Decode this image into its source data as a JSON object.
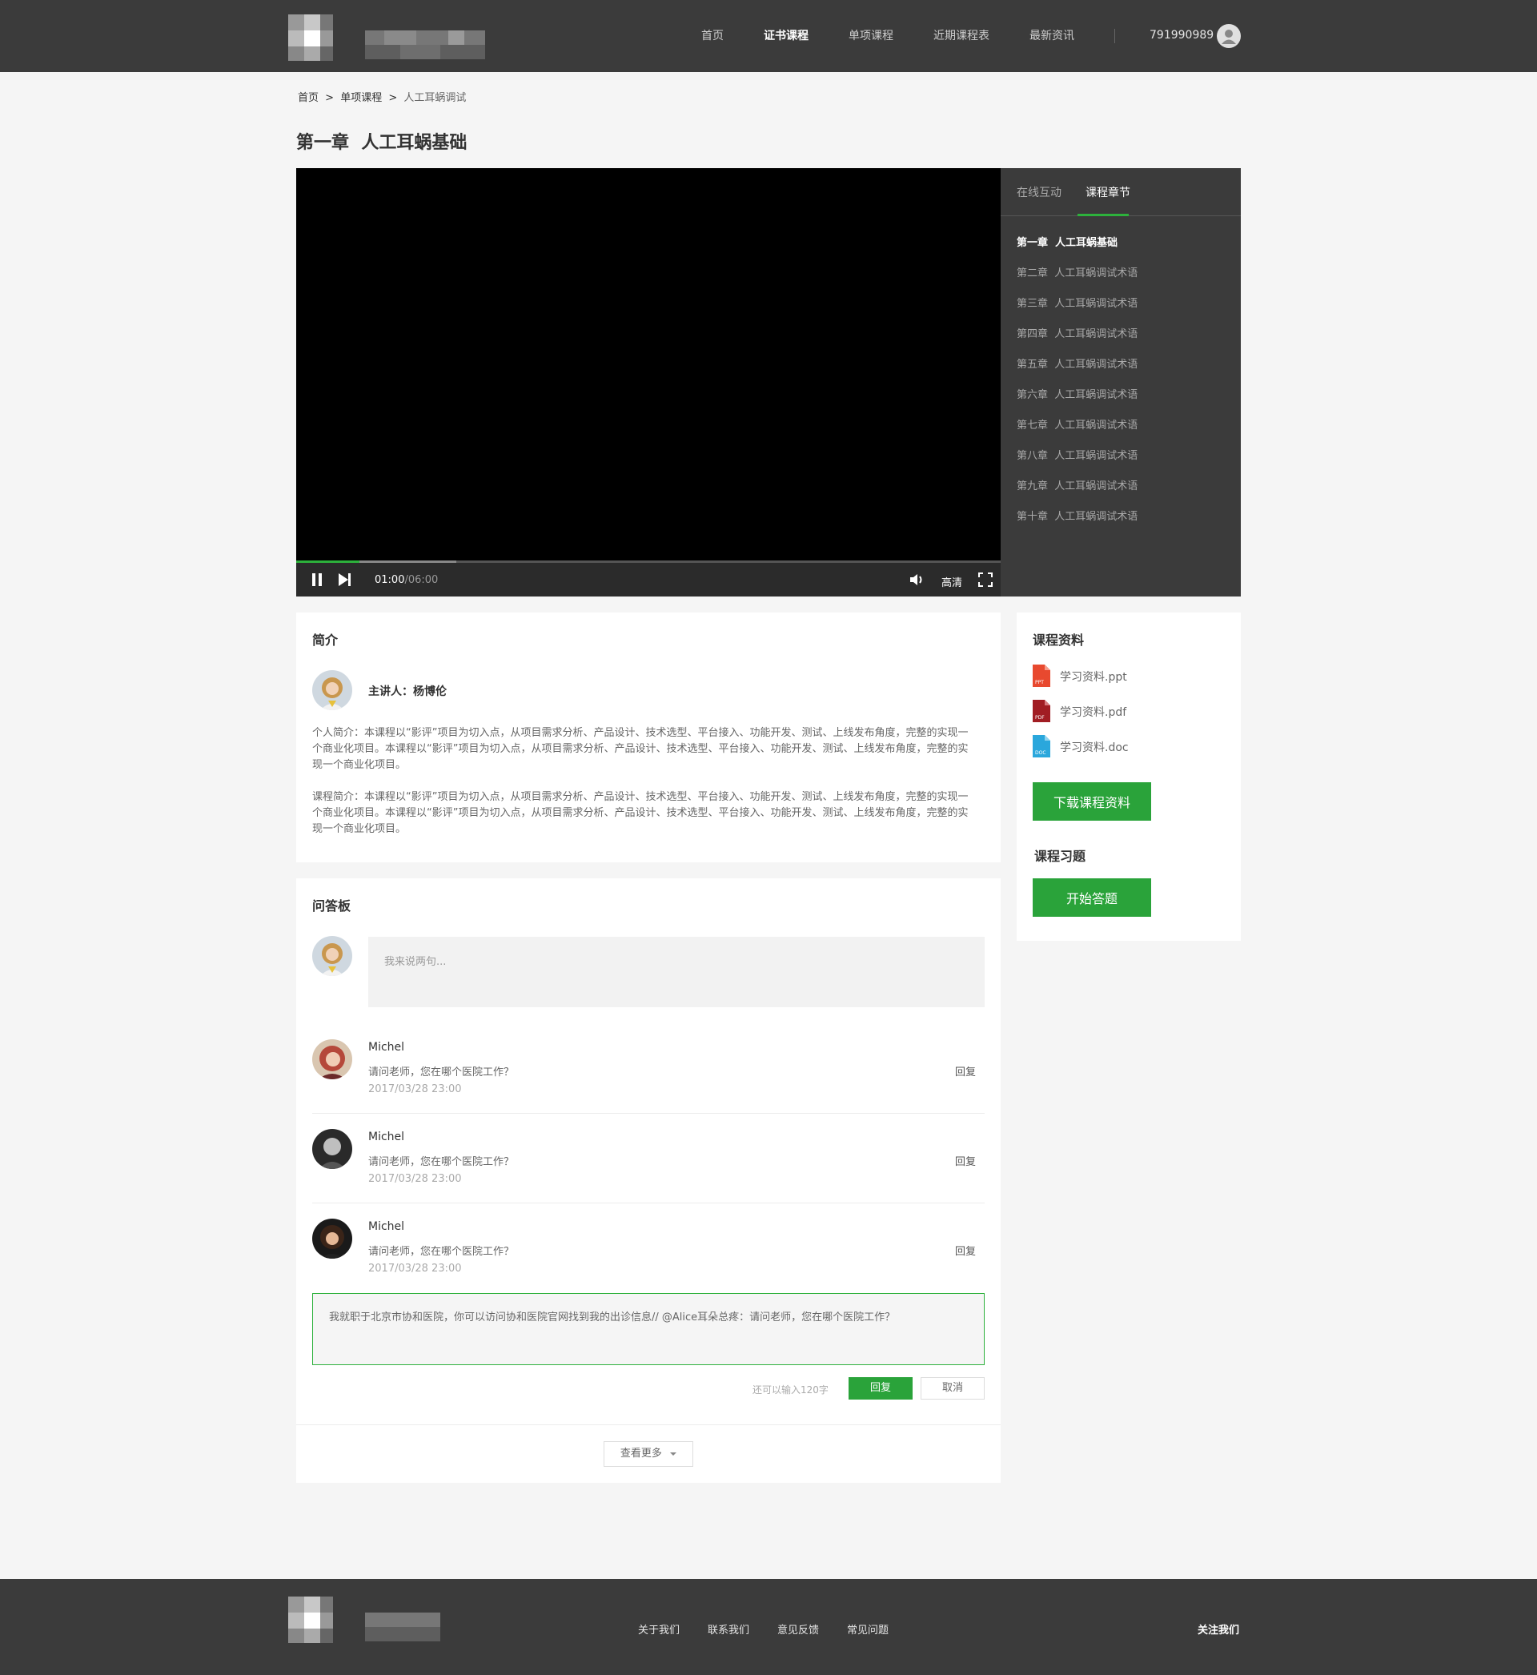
{
  "header": {
    "nav": [
      "首页",
      "证书课程",
      "单项课程",
      "近期课程表",
      "最新资讯"
    ],
    "active_nav": "证书课程",
    "user_id": "791990989"
  },
  "breadcrumb": {
    "home": "首页",
    "sep1": ">",
    "section": "单项课程",
    "sep2": ">",
    "current": "人工耳蜗调试"
  },
  "page_title": "第一章  人工耳蜗基础",
  "player": {
    "time_current": "01:00",
    "time_total": "/06:00",
    "quality": "高清",
    "progress_played": 0.09,
    "progress_buffered": 0.227
  },
  "side_tabs": [
    "在线互动",
    "课程章节"
  ],
  "chapters": [
    "第一章  人工耳蜗基础",
    "第二章  人工耳蜗调试术语",
    "第三章  人工耳蜗调试术语",
    "第四章  人工耳蜗调试术语",
    "第五章  人工耳蜗调试术语",
    "第六章  人工耳蜗调试术语",
    "第七章  人工耳蜗调试术语",
    "第八章  人工耳蜗调试术语",
    "第九章  人工耳蜗调试术语",
    "第十章  人工耳蜗调试术语"
  ],
  "intro": {
    "heading": "简介",
    "presenter": "主讲人：杨博伦",
    "personal": "个人简介：本课程以“影评”项目为切入点，从项目需求分析、产品设计、技术选型、平台接入、功能开发、测试、上线发布角度，完整的实现一个商业化项目。本课程以“影评”项目为切入点，从项目需求分析、产品设计、技术选型、平台接入、功能开发、测试、上线发布角度，完整的实现一个商业化项目。",
    "course": "课程简介：本课程以“影评”项目为切入点，从项目需求分析、产品设计、技术选型、平台接入、功能开发、测试、上线发布角度，完整的实现一个商业化项目。本课程以“影评”项目为切入点，从项目需求分析、产品设计、技术选型、平台接入、功能开发、测试、上线发布角度，完整的实现一个商业化项目。"
  },
  "materials": {
    "heading": "课程资料",
    "files": [
      {
        "name": "学习资料.ppt",
        "tag": "PPT",
        "color": "#e8492f"
      },
      {
        "name": "学习资料.pdf",
        "tag": "PDF",
        "color": "#a11d23"
      },
      {
        "name": "学习资料.doc",
        "tag": "DOC",
        "color": "#2aa7dc"
      }
    ],
    "download_label": "下载课程资料",
    "exercise_heading": "课程习题",
    "start_label": "开始答题"
  },
  "qa": {
    "heading": "问答板",
    "placeholder": "我来说两句...",
    "comments": [
      {
        "name": "Michel",
        "text": "请问老师，您在哪个医院工作？",
        "time": "2017/03/28 23:00",
        "reply": "回复"
      },
      {
        "name": "Michel",
        "text": "请问老师，您在哪个医院工作？",
        "time": "2017/03/28 23:00",
        "reply": "回复"
      },
      {
        "name": "Michel",
        "text": "请问老师，您在哪个医院工作？",
        "time": "2017/03/28 23:00",
        "reply": "回复"
      }
    ],
    "reply_text": "我就职于北京市协和医院，你可以访问协和医院官网找到我的出诊信息// @Alice耳朵总疼：请问老师，您在哪个医院工作？",
    "remaining": "还可以输入120字",
    "reply_button": "回复",
    "cancel_button": "取消",
    "more": "查看更多"
  },
  "footer": {
    "links": [
      "关于我们",
      "联系我们",
      "意见反馈",
      "常见问题"
    ],
    "follow": "关注我们"
  },
  "colors": {
    "accent": "#2aa33a",
    "header_bg": "#3b3b3b"
  }
}
